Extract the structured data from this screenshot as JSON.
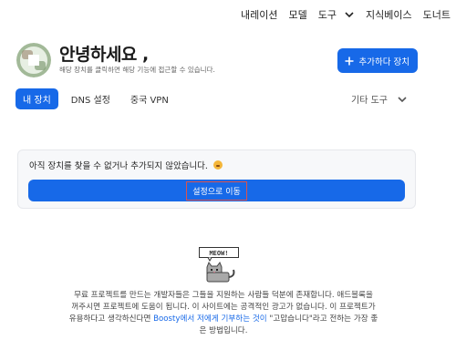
{
  "topnav": {
    "items": [
      "내레이션",
      "모델",
      "도구",
      "지식베이스",
      "도너트"
    ]
  },
  "header": {
    "greeting": "안녕하세요 ,",
    "subtitle": "해당 장치를 클릭하면 해당 기능에 접근할 수 있습니다.",
    "add_button": "추가하다 장치"
  },
  "tabs": [
    {
      "label": "내 장치",
      "active": true
    },
    {
      "label": "DNS 설정",
      "active": false
    },
    {
      "label": "중국 VPN",
      "active": false
    }
  ],
  "tools_label": "기타 도구",
  "card": {
    "message": "아직 장치를 찾을 수 없거나 추가되지 않았습니다.",
    "button": "설정으로 이동"
  },
  "mascot": {
    "bubble": "MEOW!"
  },
  "footer": {
    "line1": "무료 프로젝트를 만드는 개발자들은 그들을 지원하는 사람들 덕분에 존재합니다. 애드블록을",
    "line2": "꺼주시면 프로젝트에 도움이 됩니다. 이 사이트에는 공격적인 광고가 없습니다. 이 프로젝트가",
    "line3_pre": "유용하다고 생각하신다면 ",
    "line3_link": "Boosty에서 저에게 기부하는 것이",
    "line3_post": " \"고맙습니다\"라고 전하는 가장 좋",
    "line4": "은 방법입니다."
  },
  "colors": {
    "accent": "#1769e8"
  }
}
